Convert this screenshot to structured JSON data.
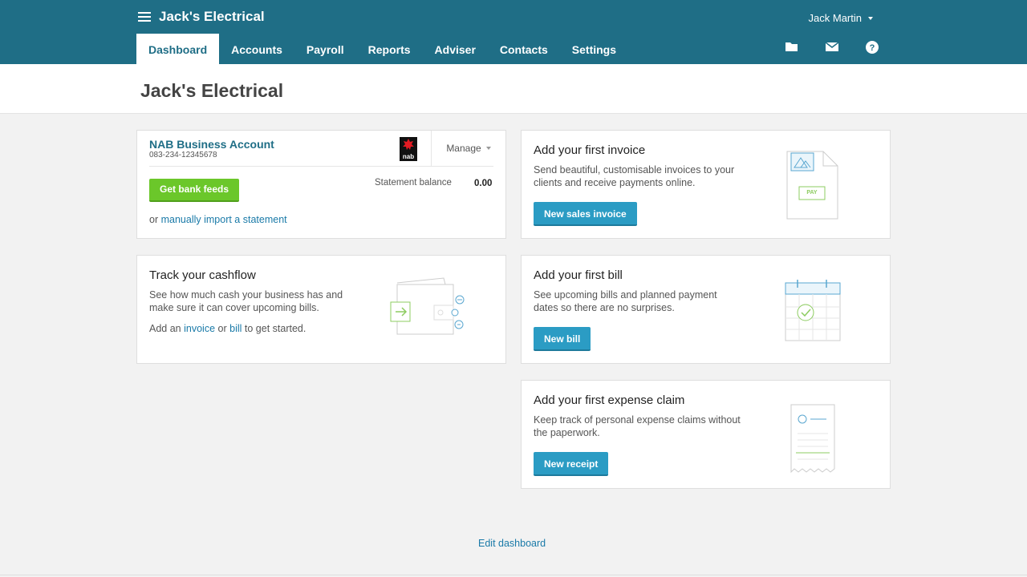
{
  "header": {
    "org_name": "Jack's Electrical",
    "user_name": "Jack Martin",
    "nav": [
      "Dashboard",
      "Accounts",
      "Payroll",
      "Reports",
      "Adviser",
      "Contacts",
      "Settings"
    ],
    "tool_icons": [
      "folder-icon",
      "mail-icon",
      "help-icon"
    ]
  },
  "page": {
    "title": "Jack's Electrical"
  },
  "bank_card": {
    "account_name": "NAB Business Account",
    "account_number": "083-234-12345678",
    "logo_text": "nab",
    "manage_label": "Manage",
    "feeds_button": "Get bank feeds",
    "statement_label": "Statement balance",
    "statement_value": "0.00",
    "import_prefix": "or",
    "import_link": "manually import a statement"
  },
  "cashflow_card": {
    "title": "Track your cashflow",
    "description": "See how much cash your business has and make sure it can cover upcoming bills.",
    "action_prefix": "Add an",
    "invoice_link": "invoice",
    "or_text": "or",
    "bill_link": "bill",
    "action_suffix": "to get started."
  },
  "invoice_card": {
    "title": "Add your first invoice",
    "description": "Send beautiful, customisable invoices to your clients and receive payments online.",
    "button": "New sales invoice",
    "illustration_text": "PAY"
  },
  "bill_card": {
    "title": "Add your first bill",
    "description": "See upcoming bills and planned payment dates so there are no surprises.",
    "button": "New bill"
  },
  "expense_card": {
    "title": "Add your first expense claim",
    "description": "Keep track of personal expense claims without the paperwork.",
    "button": "New receipt"
  },
  "footer": {
    "edit_dashboard": "Edit dashboard"
  },
  "colors": {
    "header": "#1f6e86",
    "accent_blue": "#2b9cc4",
    "accent_green": "#6bc72a",
    "link": "#1a7aa8"
  }
}
